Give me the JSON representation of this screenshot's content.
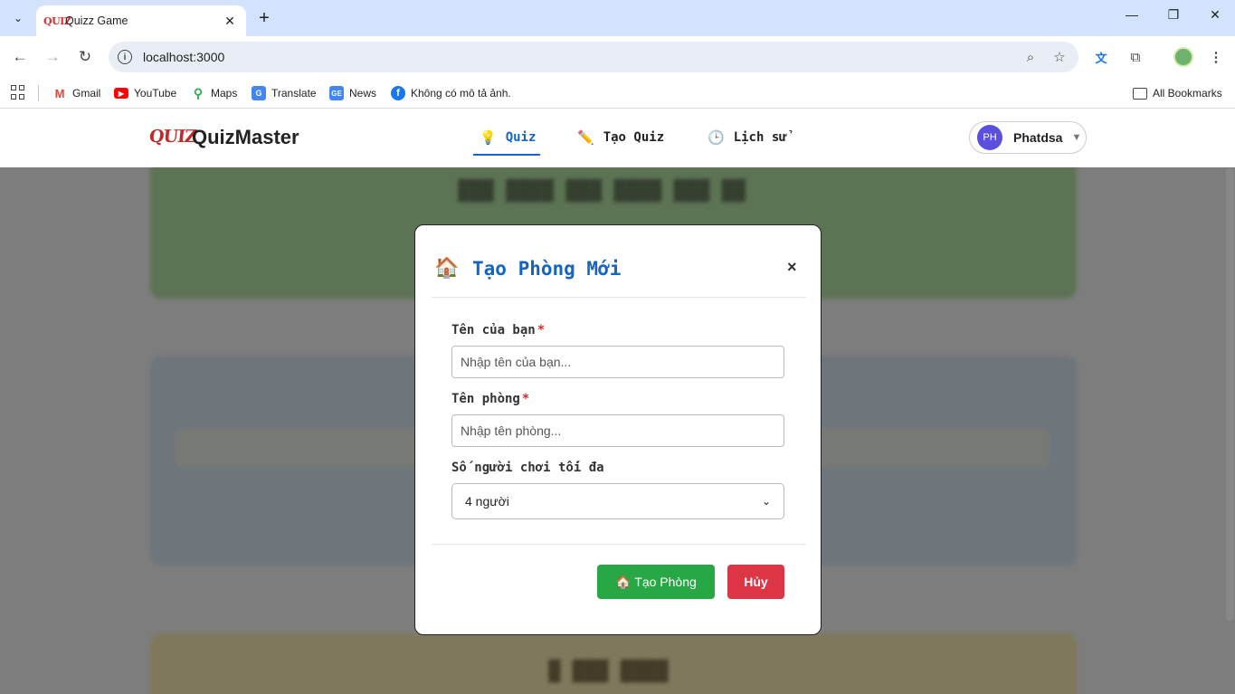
{
  "browser": {
    "tab_title": "Quizz Game",
    "tab_favicon_text": "QUIZ",
    "url": "localhost:3000",
    "bookmarks": [
      {
        "label": "Gmail",
        "icon": "gmail-icon",
        "color": "#ea4335"
      },
      {
        "label": "YouTube",
        "icon": "youtube-icon",
        "color": "#ff0000"
      },
      {
        "label": "Maps",
        "icon": "maps-icon",
        "color": "#34a853"
      },
      {
        "label": "Translate",
        "icon": "translate-icon",
        "color": "#4285f4"
      },
      {
        "label": "News",
        "icon": "news-icon",
        "color": "#4285f4"
      },
      {
        "label": "Không có mô tả ảnh.",
        "icon": "facebook-icon",
        "color": "#1877f2"
      }
    ],
    "all_bookmarks_label": "All Bookmarks"
  },
  "app": {
    "logo_mark": "QUIZ",
    "logo_text": "QuizMaster",
    "nav": [
      {
        "label": "Quiz",
        "icon": "lightbulb-icon",
        "active": true
      },
      {
        "label": "Tạo Quiz",
        "icon": "pencil-icon",
        "active": false
      },
      {
        "label": "Lịch sử",
        "icon": "clock-icon",
        "active": false
      }
    ],
    "user": {
      "initials": "PH",
      "name": "Phatdsa"
    }
  },
  "modal": {
    "icon": "house-icon",
    "title": "Tạo Phòng Mới",
    "close": "×",
    "fields": {
      "your_name_label": "Tên của bạn",
      "your_name_placeholder": "Nhập tên của bạn...",
      "room_name_label": "Tên phòng",
      "room_name_placeholder": "Nhập tên phòng...",
      "required_mark": "*",
      "max_players_label": "Số người chơi tối đa",
      "max_players_value": "4 người"
    },
    "create_button": "🏠 Tạo Phòng",
    "cancel_button": "Hủy"
  },
  "colors": {
    "primary": "#1565c0",
    "success": "#28a745",
    "danger": "#dc3545",
    "avatar": "#5b4fe0"
  }
}
